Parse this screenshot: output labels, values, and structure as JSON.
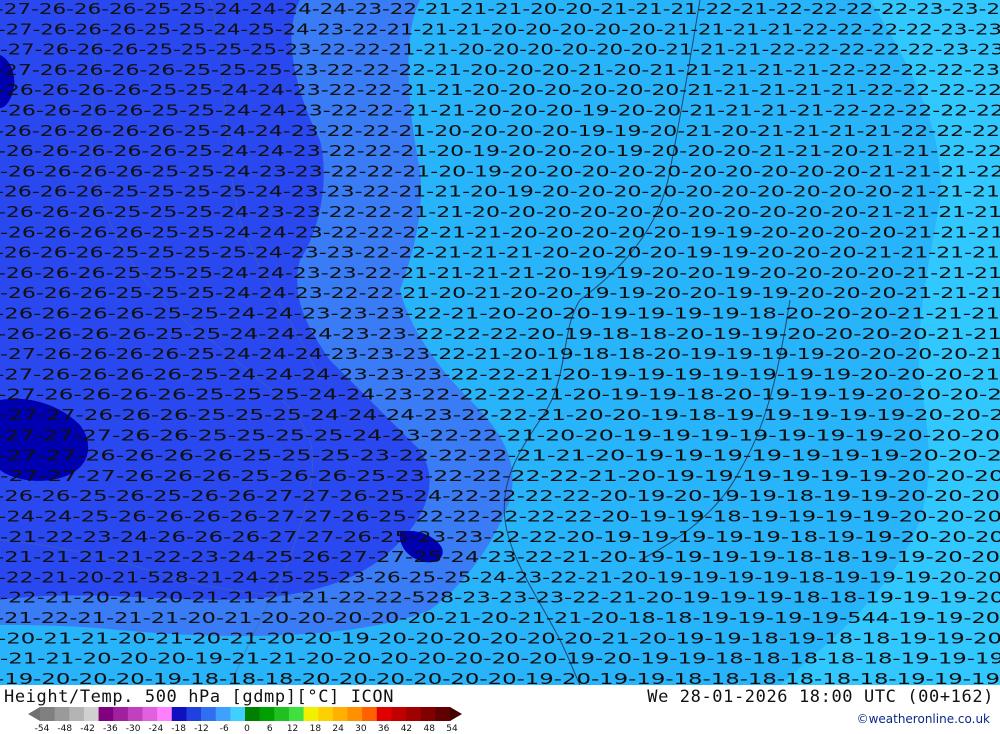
{
  "header": {
    "title_left": "Height/Temp. 500 hPa [gdmp][°C] ICON",
    "title_right": "We 28-01-2026 18:00 UTC (00+162)",
    "credit": "©weatheronline.co.uk"
  },
  "legend": {
    "tick_labels": [
      "-54",
      "-48",
      "-42",
      "-36",
      "-30",
      "-24",
      "-18",
      "-12",
      "-6",
      "0",
      "6",
      "12",
      "18",
      "24",
      "30",
      "36",
      "42",
      "48",
      "54"
    ],
    "colors": [
      "#808080",
      "#9a9a9a",
      "#b4b4b4",
      "#d0d0d0",
      "#800080",
      "#a020a0",
      "#c040c0",
      "#e060e0",
      "#ff80ff",
      "#1010c0",
      "#2040e0",
      "#3070f0",
      "#40a0ff",
      "#40d0ff",
      "#008000",
      "#00a000",
      "#20c020",
      "#40e040",
      "#f0f000",
      "#ffd000",
      "#ffb000",
      "#ff9000",
      "#ff6000",
      "#e00000",
      "#c00000",
      "#a00000",
      "#800000",
      "#600000"
    ]
  },
  "map": {
    "background_colors": {
      "deep": "#0000b0",
      "dark": "#2a48f0",
      "mid": "#3a7cf5",
      "light": "#28b4fa",
      "lightest": "#30c8ff"
    },
    "rows": [
      "-27-26-26-26-25-25-24-24-24-24-23-22-21-21-21-20-20-21-21-21-22-21-22-22-22-22-23-23-2",
      "-27-26-26-26-25-25-24-25-24-23-22-21-21-21-20-20-20-20-20-21-21-21-21-22-22-22-22-23-23",
      "-27-26-26-26-25-25-25-25-23-22-22-21-21-20-20-20-20-20-20-21-21-21-22-22-22-22-22-23-23",
      "-27-26-26-26-26-25-25-25-23-22-22-22-21-20-20-20-21-20-21-21-21-21-21-22-22-22-22-23",
      "-26-26-26-26-25-25-24-24-23-22-22-21-21-20-20-20-20-20-20-21-21-21-21-21-22-22-22-22",
      "-26-26-26-26-25-25-24-24-23-22-22-21-21-20-20-20-19-20-20-21-21-21-21-22-22-22-22-22",
      "-26-26-26-26-26-25-24-24-23-22-22-21-20-20-20-20-19-19-20-21-20-21-21-21-21-22-22-22",
      "-26-26-26-26-26-25-24-24-23-22-22-21-20-19-20-20-20-19-20-20-20-21-21-20-21-21-22-22",
      "-26-26-26-26-25-25-24-23-23-22-22-21-20-19-20-20-20-20-20-20-20-20-20-20-21-21-21-22",
      "-26-26-26-25-25-25-25-24-23-23-22-21-21-20-19-20-20-20-20-20-20-20-20-20-20-21-21-21",
      "-26-26-26-25-25-25-24-23-23-22-22-21-21-20-20-20-20-20-20-20-20-20-20-20-21-21-21-21",
      "-26-26-26-26-25-25-24-24-23-22-22-22-21-21-20-20-20-20-20-19-19-20-20-20-20-21-21-21",
      "-26-26-26-25-25-25-25-24-23-23-22-22-21-21-21-20-20-20-20-19-19-20-20-20-21-21-21-21",
      "-26-26-26-25-25-25-24-24-23-23-22-21-21-21-21-20-19-19-20-20-19-20-20-20-20-21-21-21",
      "-26-26-26-25-25-25-24-24-23-22-22-21-20-21-20-20-19-19-20-20-19-19-20-20-20-21-21-21",
      "-26-26-26-26-25-25-24-24-23-23-23-22-21-20-20-20-19-19-19-19-18-20-20-20-21-21-21",
      "-26-26-26-26-25-25-24-24-24-23-23-22-22-22-20-19-18-18-20-19-19-20-20-20-20-21-21",
      "-27-26-26-26-26-25-24-24-24-23-23-23-22-21-20-19-18-18-20-19-19-19-19-20-20-20-20-21",
      "-27-26-26-26-26-25-24-24-24-23-23-23-22-22-21-20-19-19-19-19-19-19-19-20-20-20-21",
      "-27-26-26-26-26-25-25-25-24-24-23-22-22-22-21-20-19-19-18-20-19-19-19-20-20-20-2",
      "-27-27-26-26-26-25-25-25-24-24-24-23-22-22-21-20-20-19-18-19-19-19-19-19-20-20-2",
      "-27-27-27-26-26-25-25-25-25-24-23-22-22-21-20-20-19-19-19-19-19-19-19-20-20-20",
      "-27-27-26-26-26-26-25-25-25-23-22-22-22-21-21-20-19-19-19-19-19-19-19-20-20-2",
      "-27-27-27-26-26-26-25-26-26-25-23-22-22-22-22-21-20-19-19-19-19-19-19-20-20-20",
      "-26-26-25-26-25-26-26-27-27-26-25-24-22-22-22-22-20-19-20-19-19-18-19-19-20-20-20",
      "-24-24-25-26-26-26-26-27-27-26-25-22-22-22-22-22-20-19-19-18-19-19-19-19-20-20-20",
      "-21-22-23-24-26-26-26-27-27-26-25-23-23-22-22-20-19-19-19-19-19-18-19-19-20-20-20",
      "-21-21-21-21-22-23-24-25-26-27-27-25-24-23-22-21-20-19-19-19-19-18-18-19-19-20-20",
      "-22-21-20-21-528-21-24-25-25-23-26-25-25-24-23-22-21-20-19-19-19-19-18-19-19-19-20-20",
      "-22-21-20-21-20-21-21-21-21-22-22-528-23-23-23-22-21-20-19-19-19-18-18-19-19-19-20",
      "-21-22-21-21-21-20-21-20-20-20-20-20-21-20-21-21-20-18-18-19-19-19-19-544-19-19-20",
      "-20-21-21-20-21-20-21-20-20-19-20-20-20-20-20-20-21-20-19-19-18-19-18-18-19-19-20",
      "-21-21-20-20-20-19-21-21-20-20-20-20-20-20-20-19-20-19-19-18-18-18-18-18-19-19-19",
      "-19-20-20-20-19-18-18-18-20-20-20-20-20-20-19-20-19-19-18-18-18-18-18-18-19-19-19"
    ]
  }
}
